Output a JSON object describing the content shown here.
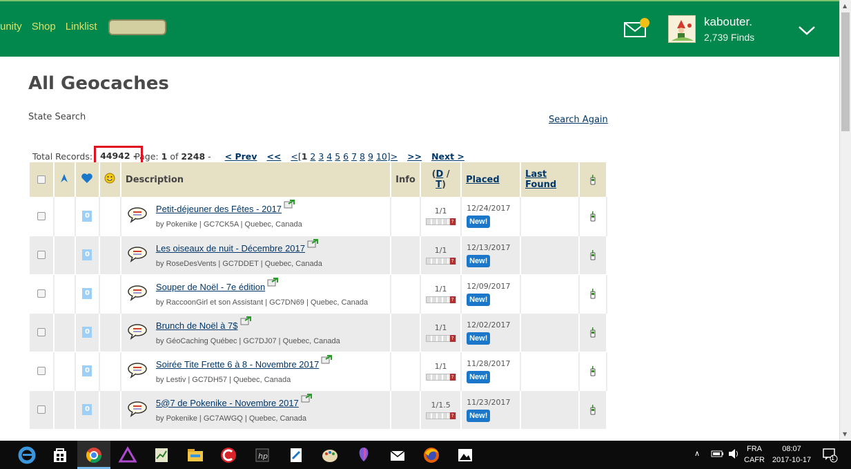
{
  "header": {
    "nav": [
      "unity",
      "Shop",
      "Linklist"
    ],
    "user_name": "kabouter.",
    "user_finds": "2,739 Finds",
    "brand_green": "#02874d"
  },
  "page": {
    "title": "All Geocaches",
    "subtitle": "State Search",
    "search_again": "Search Again"
  },
  "pagination": {
    "total_label": "Total Records:",
    "total": "44942",
    "total_suffix": "-",
    "page_label": "Page:",
    "page": "1",
    "of_label": "of",
    "pages": "2248",
    "dash": "-",
    "prev": "< Prev",
    "first": "<<",
    "open_bracket": "<[",
    "pages_list": [
      "1",
      "2",
      "3",
      "4",
      "5",
      "6",
      "7",
      "8",
      "9",
      "10"
    ],
    "close_bracket": "]>",
    "last": ">>",
    "next": "Next >"
  },
  "table": {
    "headers": {
      "description": "Description",
      "info": "Info",
      "dt_d": "D",
      "dt_sep": " / ",
      "dt_t": "T",
      "dt_open": "(",
      "dt_close": ")",
      "placed": "Placed",
      "last_found": "Last Found"
    },
    "new_label": "New!",
    "rows": [
      {
        "name": "Petit-déjeuner des Fêtes - 2017",
        "meta": "by Pokenike | GC7CK5A | Quebec, Canada",
        "fav": "0",
        "dt": "1/1",
        "placed": "12/24/2017"
      },
      {
        "name": "Les oiseaux de nuit - Décembre 2017",
        "meta": "by RoseDesVents | GC7DDET | Quebec, Canada",
        "fav": "0",
        "dt": "1/1",
        "placed": "12/13/2017"
      },
      {
        "name": "Souper de Noël - 7e édition",
        "meta": "by RaccoonGirl et son Assistant | GC7DN69 | Quebec, Canada",
        "fav": "0",
        "dt": "1/1",
        "placed": "12/09/2017"
      },
      {
        "name": "Brunch de Noël à 7$",
        "meta": "by GéoCaching Québec | GC7DJ07 | Quebec, Canada",
        "fav": "0",
        "dt": "1/1",
        "placed": "12/02/2017"
      },
      {
        "name": "Soirée Tite Frette 6 à 8 - Novembre 2017",
        "meta": "by Lestiv | GC7DH57 | Quebec, Canada",
        "fav": "0",
        "dt": "1/1",
        "placed": "11/28/2017"
      },
      {
        "name": "5@7 de Pokenike - Novembre 2017",
        "meta": "by Pokenike | GC7AWGQ | Quebec, Canada",
        "fav": "0",
        "dt": "1/1.5",
        "placed": "11/23/2017"
      }
    ]
  },
  "taskbar": {
    "language_top": "FRA",
    "language_bottom": "CAFR",
    "time": "08:07",
    "date": "2017-10-17",
    "notifications": "1"
  }
}
